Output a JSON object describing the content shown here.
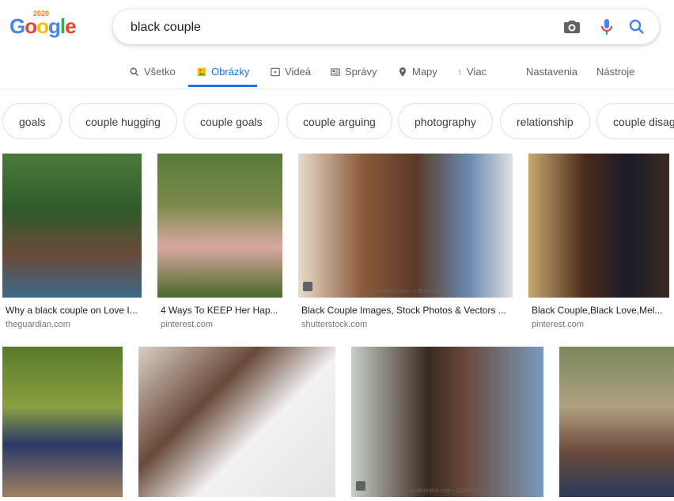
{
  "logo": {
    "text": "Google",
    "year": "2020"
  },
  "search": {
    "query": "black couple"
  },
  "tabs": [
    {
      "label": "Všetko",
      "icon": "search-icon"
    },
    {
      "label": "Obrázky",
      "icon": "image-icon",
      "active": true
    },
    {
      "label": "Videá",
      "icon": "video-icon"
    },
    {
      "label": "Správy",
      "icon": "news-icon"
    },
    {
      "label": "Mapy",
      "icon": "map-pin-icon"
    },
    {
      "label": "Viac",
      "icon": "more-vert-icon"
    },
    {
      "label": "Nastavenia"
    },
    {
      "label": "Nástroje"
    }
  ],
  "chips": [
    "goals",
    "couple hugging",
    "couple goals",
    "couple arguing",
    "photography",
    "relationship",
    "couple disag"
  ],
  "results": [
    {
      "caption": "Why a black couple on Love I...",
      "source": "theguardian.com"
    },
    {
      "caption": "4 Ways To KEEP Her Hap...",
      "source": "pinterest.com"
    },
    {
      "caption": "Black Couple Images, Stock Photos & Vectors ...",
      "source": "shutterstock.com",
      "watermark": "shutterstock.com • 1361685944"
    },
    {
      "caption": "Black Couple,Black Love,Mel...",
      "source": "pinterest.com"
    },
    {
      "caption": "",
      "source": ""
    },
    {
      "caption": "",
      "source": ""
    },
    {
      "caption": "",
      "source": "",
      "watermark": "shutterstock.com • 1180647805"
    },
    {
      "caption": "",
      "source": ""
    }
  ],
  "colors": {
    "accent": "#1a73e8",
    "muted": "#5f6368"
  }
}
